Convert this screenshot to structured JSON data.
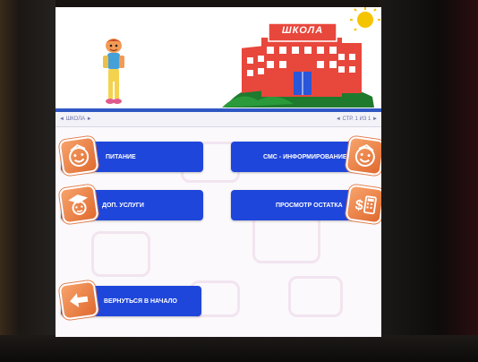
{
  "header": {
    "school_sign": "ШКОЛА"
  },
  "breadcrumb": {
    "left": "◄ ШКОЛА ►",
    "right": "◄ СТР. 1 ИЗ 1 ►"
  },
  "menu": {
    "nutrition": "ПИТАНИЕ",
    "sms_info": "СМС - ИНФОРМИРОВАНИЕ",
    "extra_services": "ДОП. УСЛУГИ",
    "view_balance": "ПРОСМОТР ОСТАТКА",
    "back_to_start": "ВЕРНУТЬСЯ В НАЧАЛО"
  },
  "icons": {
    "nutrition": "smiley-face-icon",
    "sms_info": "smiley-face-icon",
    "extra_services": "graduation-face-icon",
    "view_balance": "money-calculator-icon",
    "back_to_start": "back-arrow-icon"
  },
  "colors": {
    "button": "#1f46db",
    "header_rule": "#2f57c4",
    "badge": "#ef8a4d",
    "school_building": "#e8473c",
    "sun": "#f5c400"
  }
}
